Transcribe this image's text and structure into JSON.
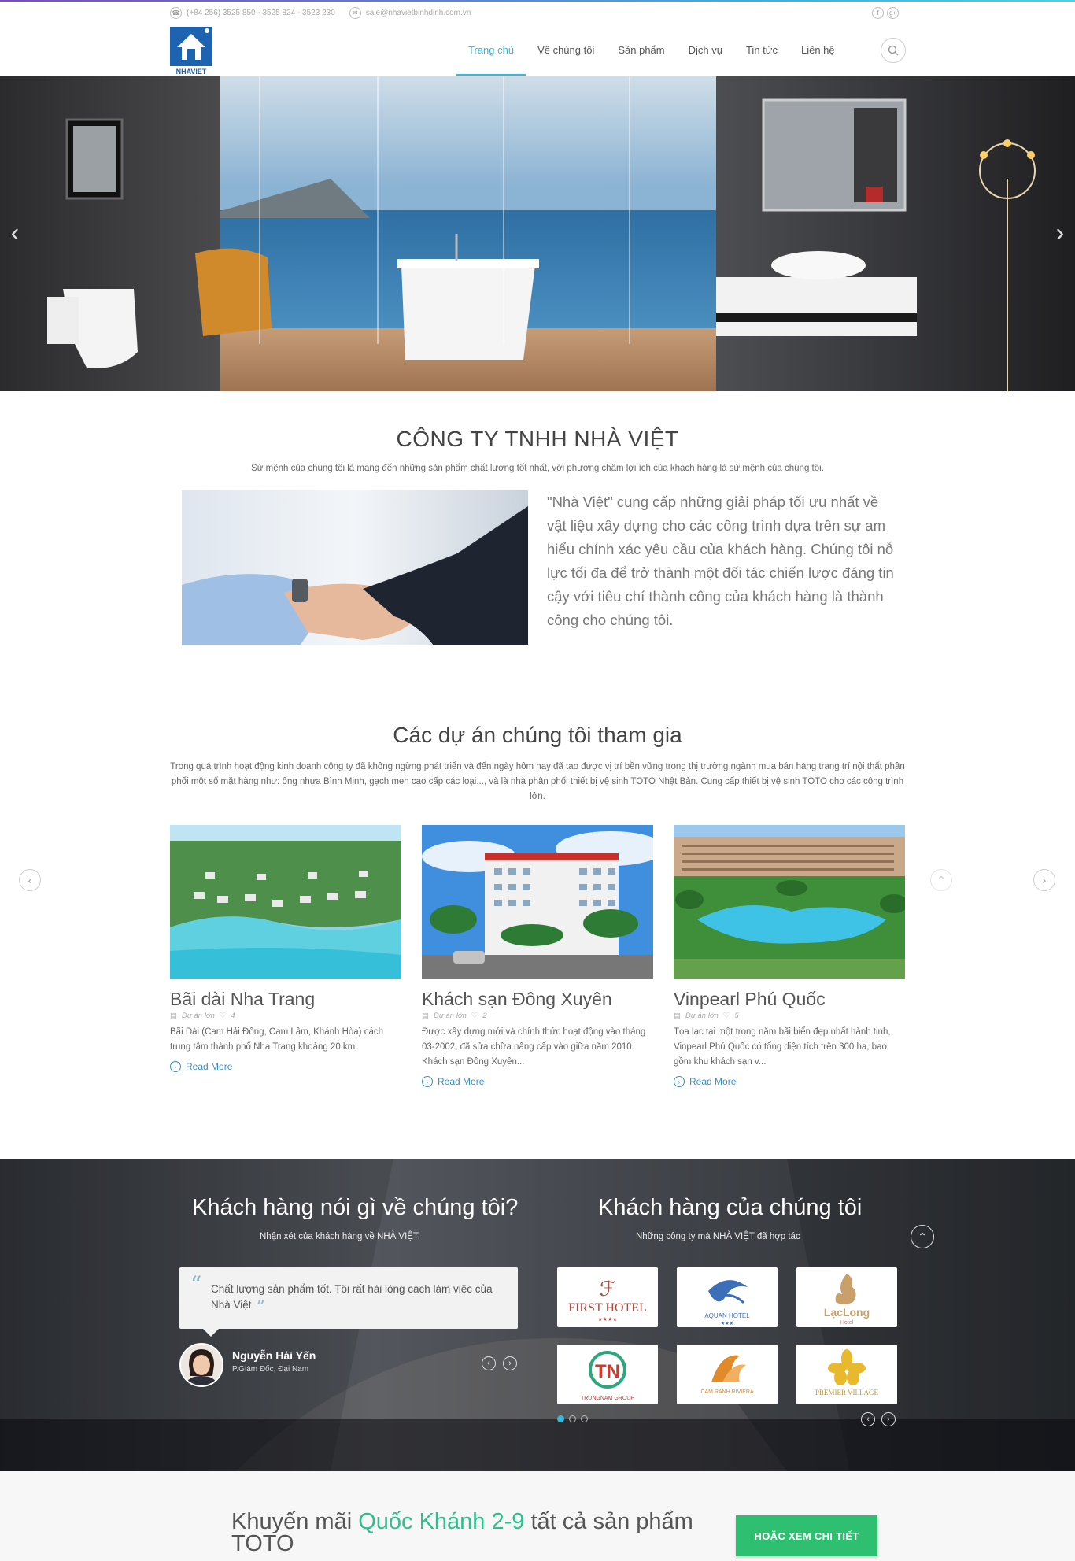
{
  "topbar": {
    "phone": "(+84 256) 3525 850 - 3525 824 - 3523 230",
    "email": "sale@nhavietbinhdinh.com.vn",
    "social": [
      {
        "icon": "facebook-icon",
        "glyph": "f"
      },
      {
        "icon": "google-plus-icon",
        "glyph": "g+"
      }
    ]
  },
  "logo": {
    "text": "NHAVIET"
  },
  "nav": {
    "items": [
      {
        "label": "Trang chủ",
        "active": true
      },
      {
        "label": "Về chúng tôi",
        "active": false
      },
      {
        "label": "Sản phẩm",
        "active": false
      },
      {
        "label": "Dịch vụ",
        "active": false
      },
      {
        "label": "Tin tức",
        "active": false
      },
      {
        "label": "Liên hệ",
        "active": false
      }
    ],
    "accent": "#35b8df"
  },
  "hero": {
    "prev": "‹",
    "next": "›"
  },
  "company": {
    "title": "CÔNG TY TNHH NHÀ VIỆT",
    "subtitle": "Sứ mệnh của chúng tôi là mang đến những sản phẩm chất lượng tốt nhất, với phương châm lợi ích của khách hàng là sứ mệnh của chúng tôi.",
    "text": "\"Nhà Việt\" cung cấp những giải pháp tối ưu nhất về vật liệu xây dựng cho các công trình dựa trên sự am hiểu chính xác yêu cầu của khách hàng. Chúng tôi nỗ lực tối đa để trở thành một đối tác chiến lược đáng tin cậy với tiêu chí thành công của khách hàng là thành công cho chúng tôi."
  },
  "projects": {
    "title": "Các dự án chúng tôi tham gia",
    "description": "Trong quá trình hoạt động kinh doanh công ty đã không ngừng phát triển và đến ngày hôm nay đã tạo được vị trí bền vững trong thị trường ngành mua bán hàng trang trí nội thất phân phối một số mặt hàng như: ống nhựa Bình Minh, gạch men cao cấp các loại..., và là nhà phân phối thiết bị vệ sinh TOTO Nhật Bản. Cung cấp thiết bị vệ sinh TOTO cho các công trình lớn.",
    "cards": [
      {
        "title": "Bãi dài Nha Trang",
        "category": "Dự án lớn",
        "likes": "4",
        "text": "Bãi Dài (Cam Hải Đông, Cam Lâm, Khánh Hòa) cách trung tâm thành phố Nha Trang khoảng 20 km.",
        "more": "Read More"
      },
      {
        "title": "Khách sạn Đông Xuyên",
        "category": "Dự án lớn",
        "likes": "2",
        "text": "Được xây dựng mới và chính thức hoạt động vào tháng 03-2002, đã sửa chữa nâng cấp vào giữa năm 2010. Khách sạn Đông Xuyên...",
        "more": "Read More"
      },
      {
        "title": "Vinpearl Phú Quốc",
        "category": "Dự án lớn",
        "likes": "5",
        "text": "Tọa lạc tại một trong năm bãi biển đẹp nhất hành tinh, Vinpearl Phú Quốc có tổng diện tích trên 300 ha, bao gồm khu khách sạn v...",
        "more": "Read More"
      }
    ]
  },
  "testimonials": {
    "title": "Khách hàng nói gì về chúng tôi?",
    "subtitle": "Nhận xét của khách hàng về NHÀ VIỆT.",
    "quote": "Chất lượng sản phẩm tốt. Tôi rất hài lòng cách làm việc của Nhà Việt",
    "name": "Nguyễn Hải Yến",
    "role": "P.Giám Đốc, Đại Nam"
  },
  "clients": {
    "title": "Khách hàng của chúng tôi",
    "subtitle": "Những công ty mà NHÀ VIỆT đã hợp tác",
    "logos": [
      {
        "name": "FIRST HOTEL",
        "tag": "★★★★",
        "color": "#b5483f"
      },
      {
        "name": "AQUAN HOTEL",
        "tag": "★★★",
        "color": "#3c6fb8"
      },
      {
        "name": "LạcLong",
        "tag": "Hotel",
        "color": "#c9a06a"
      },
      {
        "name": "TRUNGNAM GROUP",
        "tag": "",
        "color": "#d03a2e"
      },
      {
        "name": "CAM RANH RIVIERA",
        "tag": "",
        "color": "#e08a2a"
      },
      {
        "name": "PREMIER VILLAGE",
        "tag": "",
        "color": "#e8b92c"
      }
    ]
  },
  "cta": {
    "prefix": "Khuyến mãi ",
    "highlight": "Quốc Khánh 2-9",
    "suffix": " tất cả sản phẩm TOTO",
    "button": "HOẶC XEM CHI TIẾT",
    "highlight_color": "#2fbf8f",
    "button_color": "#2fbf71"
  }
}
